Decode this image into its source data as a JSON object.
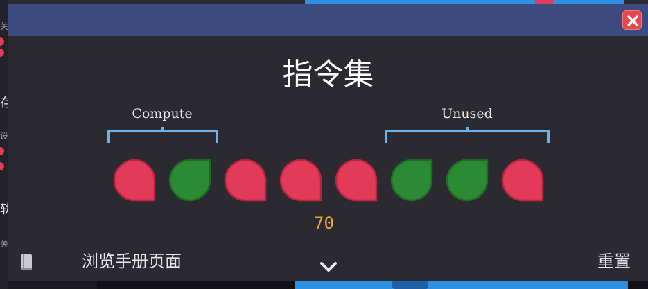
{
  "dialog": {
    "title": "指令集",
    "groups": [
      {
        "label": "Compute"
      },
      {
        "label": "Unused"
      }
    ],
    "instructions": [
      {
        "state": "off"
      },
      {
        "state": "on"
      },
      {
        "state": "off"
      },
      {
        "state": "off"
      },
      {
        "state": "off"
      },
      {
        "state": "on"
      },
      {
        "state": "on"
      },
      {
        "state": "off"
      }
    ],
    "value": "70",
    "footer": {
      "manual_label": "浏览手册页面",
      "reset_label": "重置"
    }
  },
  "background": {
    "left_chars": [
      "关",
      "存",
      "设",
      "轨",
      "关"
    ]
  },
  "colors": {
    "on": "#2b8a34",
    "off": "#e23b5a",
    "accent": "#e6a83a",
    "title_bar": "#3c4a80",
    "bracket": "#6fb0ee"
  },
  "icons": {
    "close": "close-icon",
    "book": "book-icon",
    "chevron": "chevron-down-icon"
  }
}
